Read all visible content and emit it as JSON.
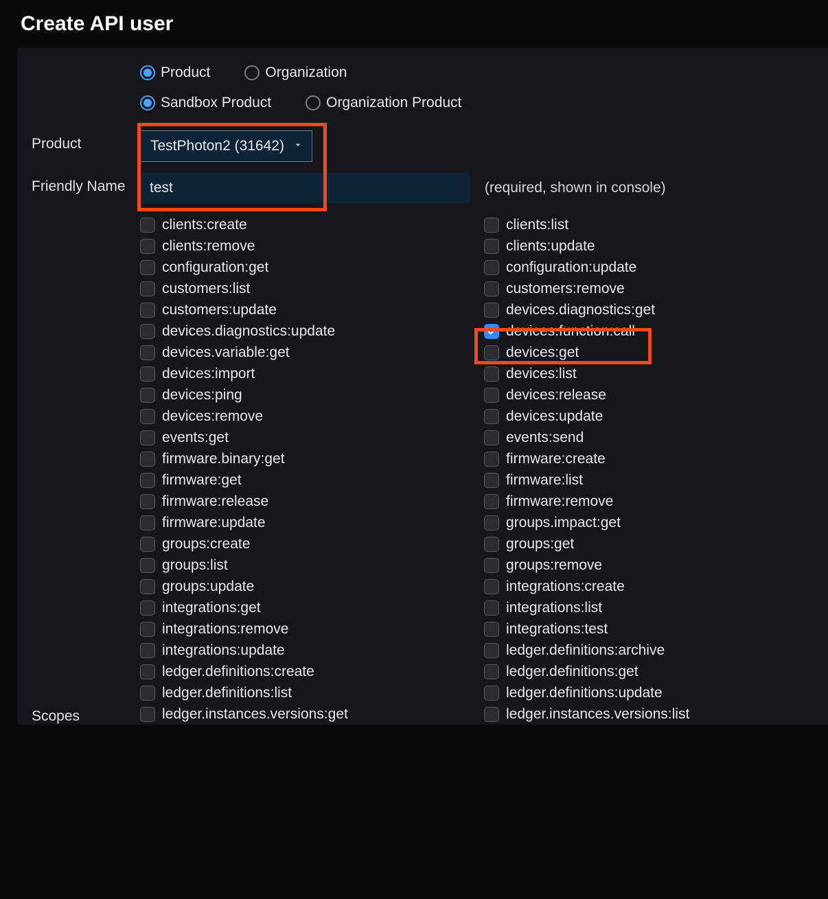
{
  "title": "Create API user",
  "radios1": {
    "opt1": {
      "label": "Product",
      "selected": true
    },
    "opt2": {
      "label": "Organization",
      "selected": false
    }
  },
  "radios2": {
    "opt1": {
      "label": "Sandbox Product",
      "selected": true
    },
    "opt2": {
      "label": "Organization Product",
      "selected": false
    }
  },
  "product": {
    "label": "Product",
    "selected": "TestPhoton2 (31642)"
  },
  "friendlyName": {
    "label": "Friendly Name",
    "value": "test",
    "hint": "(required, shown in console)"
  },
  "scopesLabel": "Scopes",
  "scopes": {
    "left": [
      {
        "label": "clients:create",
        "checked": false
      },
      {
        "label": "clients:remove",
        "checked": false
      },
      {
        "label": "configuration:get",
        "checked": false
      },
      {
        "label": "customers:list",
        "checked": false
      },
      {
        "label": "customers:update",
        "checked": false
      },
      {
        "label": "devices.diagnostics:update",
        "checked": false
      },
      {
        "label": "devices.variable:get",
        "checked": false
      },
      {
        "label": "devices:import",
        "checked": false
      },
      {
        "label": "devices:ping",
        "checked": false
      },
      {
        "label": "devices:remove",
        "checked": false
      },
      {
        "label": "events:get",
        "checked": false
      },
      {
        "label": "firmware.binary:get",
        "checked": false
      },
      {
        "label": "firmware:get",
        "checked": false
      },
      {
        "label": "firmware:release",
        "checked": false
      },
      {
        "label": "firmware:update",
        "checked": false
      },
      {
        "label": "groups:create",
        "checked": false
      },
      {
        "label": "groups:list",
        "checked": false
      },
      {
        "label": "groups:update",
        "checked": false
      },
      {
        "label": "integrations:get",
        "checked": false
      },
      {
        "label": "integrations:remove",
        "checked": false
      },
      {
        "label": "integrations:update",
        "checked": false
      },
      {
        "label": "ledger.definitions:create",
        "checked": false
      },
      {
        "label": "ledger.definitions:list",
        "checked": false
      },
      {
        "label": "ledger.instances.versions:get",
        "checked": false
      }
    ],
    "right": [
      {
        "label": "clients:list",
        "checked": false
      },
      {
        "label": "clients:update",
        "checked": false
      },
      {
        "label": "configuration:update",
        "checked": false
      },
      {
        "label": "customers:remove",
        "checked": false
      },
      {
        "label": "devices.diagnostics:get",
        "checked": false
      },
      {
        "label": "devices.function:call",
        "checked": true
      },
      {
        "label": "devices:get",
        "checked": false
      },
      {
        "label": "devices:list",
        "checked": false
      },
      {
        "label": "devices:release",
        "checked": false
      },
      {
        "label": "devices:update",
        "checked": false
      },
      {
        "label": "events:send",
        "checked": false
      },
      {
        "label": "firmware:create",
        "checked": false
      },
      {
        "label": "firmware:list",
        "checked": false
      },
      {
        "label": "firmware:remove",
        "checked": false
      },
      {
        "label": "groups.impact:get",
        "checked": false
      },
      {
        "label": "groups:get",
        "checked": false
      },
      {
        "label": "groups:remove",
        "checked": false
      },
      {
        "label": "integrations:create",
        "checked": false
      },
      {
        "label": "integrations:list",
        "checked": false
      },
      {
        "label": "integrations:test",
        "checked": false
      },
      {
        "label": "ledger.definitions:archive",
        "checked": false
      },
      {
        "label": "ledger.definitions:get",
        "checked": false
      },
      {
        "label": "ledger.definitions:update",
        "checked": false
      },
      {
        "label": "ledger.instances.versions:list",
        "checked": false
      }
    ]
  }
}
